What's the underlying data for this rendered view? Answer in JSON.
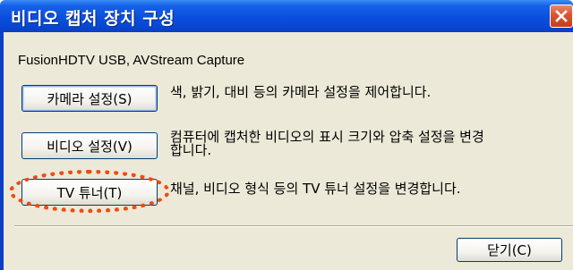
{
  "window": {
    "title": "비디오 캡처 장치 구성"
  },
  "device_name": "FusionHDTV USB, AVStream Capture",
  "rows": [
    {
      "button_label": "카메라 설정(S)",
      "description": "색, 밝기, 대비 등의 카메라 설정을 제어합니다."
    },
    {
      "button_label": "비디오 설정(V)",
      "description_line1": "컴퓨터에 캡처한 비디오의 표시 크기와 압축 설정을 변경",
      "description_line2": "합니다."
    },
    {
      "button_label": "TV 튜너(T)",
      "description": "채널, 비디오 형식 등의 TV 튜너 설정을 변경합니다."
    }
  ],
  "close_button_label": "닫기(C)",
  "colors": {
    "titlebar": "#0a4fdc",
    "client_bg": "#ece9d8",
    "highlight": "#f04a10",
    "close_icon": "#d9542e"
  },
  "icons": {
    "close": "close-icon"
  }
}
